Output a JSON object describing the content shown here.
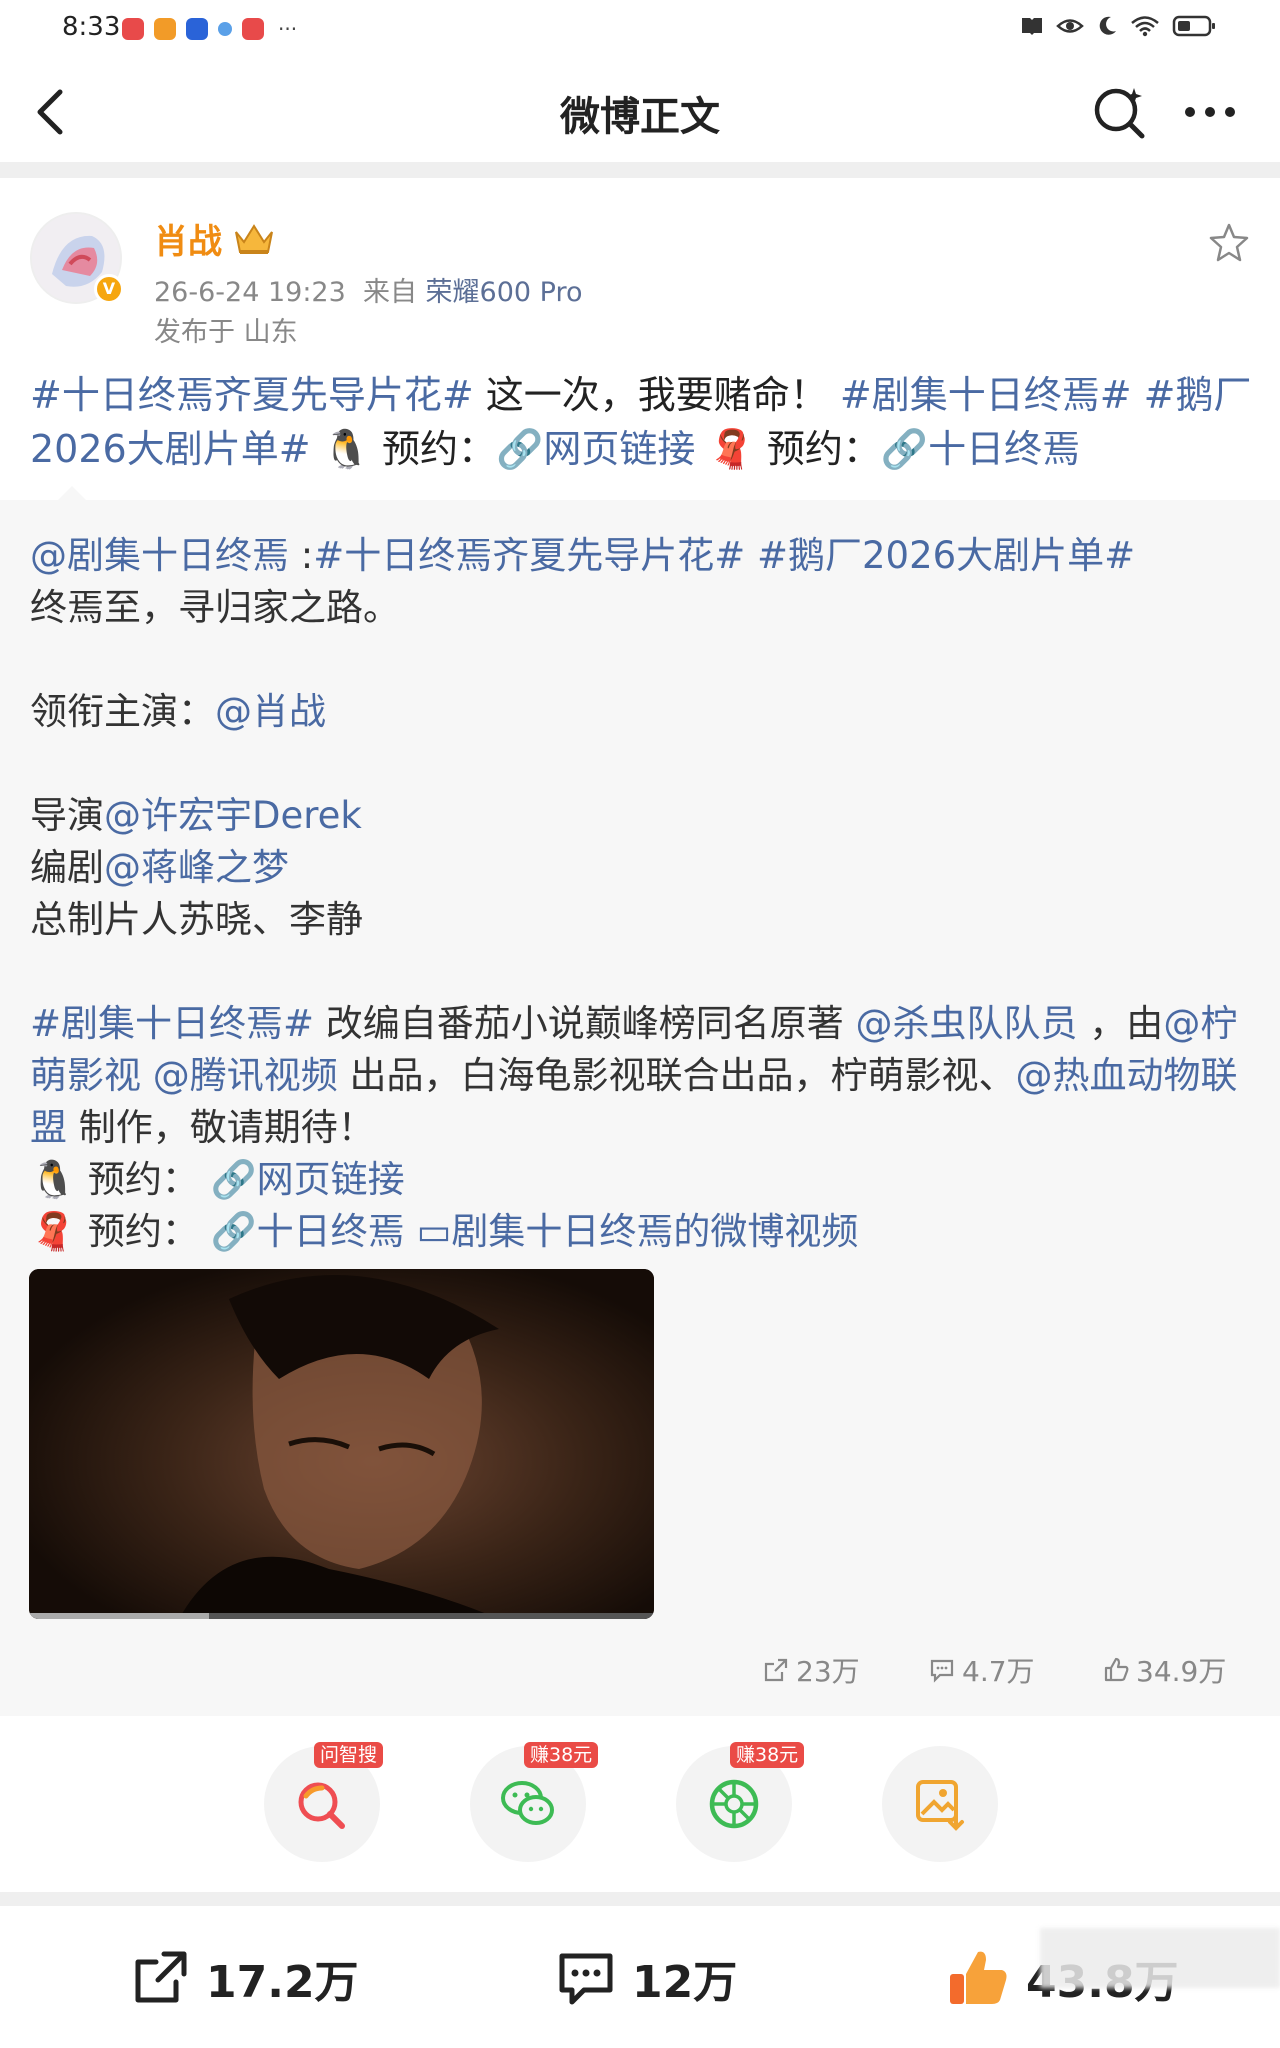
{
  "status_bar": {
    "time": "8:33",
    "more": "···"
  },
  "header": {
    "title": "微博正文"
  },
  "post": {
    "author": "肖战",
    "time": "26-6-24 19:23",
    "from_prefix": "来自",
    "source": "荣耀600 Pro",
    "location": "发布于 山东",
    "text": [
      {
        "t": "#十日终焉齐夏先导片花#",
        "link": true
      },
      {
        "t": " 这一次，我要赌命！ ",
        "link": false
      },
      {
        "t": "#剧集十日终焉#",
        "link": true
      },
      {
        "t": " ",
        "link": false
      },
      {
        "t": "#鹅厂2026大剧片单#",
        "link": true
      },
      {
        "t": " 🐧 预约：",
        "link": false
      },
      {
        "t": "🔗网页链接",
        "link": true
      },
      {
        "t": " 🧣 预约：",
        "link": false
      },
      {
        "t": "🔗十日终焉",
        "link": true
      }
    ]
  },
  "repost": {
    "lines": [
      [
        {
          "t": "@剧集十日终焉",
          "link": true
        },
        {
          "t": " :",
          "link": false
        },
        {
          "t": "#十日终焉齐夏先导片花#",
          "link": true
        },
        {
          "t": " ",
          "link": false
        },
        {
          "t": "#鹅厂2026大剧片单#",
          "link": true
        }
      ],
      [
        {
          "t": "终焉至，寻归家之路。",
          "link": false
        }
      ],
      [],
      [
        {
          "t": "领衔主演：",
          "link": false
        },
        {
          "t": "@肖战",
          "link": true
        }
      ],
      [],
      [
        {
          "t": "导演",
          "link": false
        },
        {
          "t": "@许宏宇Derek",
          "link": true
        }
      ],
      [
        {
          "t": "编剧",
          "link": false
        },
        {
          "t": "@蒋峰之梦",
          "link": true
        }
      ],
      [
        {
          "t": "总制片人苏晓、李静",
          "link": false
        }
      ],
      [],
      [
        {
          "t": "#剧集十日终焉#",
          "link": true
        },
        {
          "t": " 改编自番茄小说巅峰榜同名原著 ",
          "link": false
        },
        {
          "t": "@杀虫队队员",
          "link": true
        },
        {
          "t": " ，由",
          "link": false
        },
        {
          "t": "@柠萌影视",
          "link": true
        },
        {
          "t": " ",
          "link": false
        },
        {
          "t": "@腾讯视频",
          "link": true
        },
        {
          "t": " 出品，白海龟影视联合出品，柠萌影视、",
          "link": false
        },
        {
          "t": "@热血动物联盟",
          "link": true
        },
        {
          "t": " 制作，敬请期待！",
          "link": false
        }
      ],
      [
        {
          "t": "🐧 预约： ",
          "link": false
        },
        {
          "t": "🔗网页链接",
          "link": true
        }
      ],
      [
        {
          "t": "🧣 预约： ",
          "link": false
        },
        {
          "t": "🔗十日终焉",
          "link": true
        },
        {
          "t": "  ",
          "link": false
        },
        {
          "t": "▭剧集十日终焉的微博视频",
          "link": true
        }
      ]
    ],
    "repost_count": "23万",
    "comment_count": "4.7万",
    "like_count": "34.9万"
  },
  "quick_actions": [
    {
      "tag": "问智搜",
      "icon": "search-ai-icon"
    },
    {
      "tag": "赚38元",
      "icon": "wechat-icon"
    },
    {
      "tag": "赚38元",
      "icon": "moments-icon"
    },
    {
      "tag": "",
      "icon": "save-image-icon"
    }
  ],
  "bottom_bar": {
    "repost": "17.2万",
    "comment": "12万",
    "like": "43.8万"
  },
  "colors": {
    "link": "#4a6aa3",
    "author": "#f08c12",
    "tag_red": "#ea4b46"
  }
}
